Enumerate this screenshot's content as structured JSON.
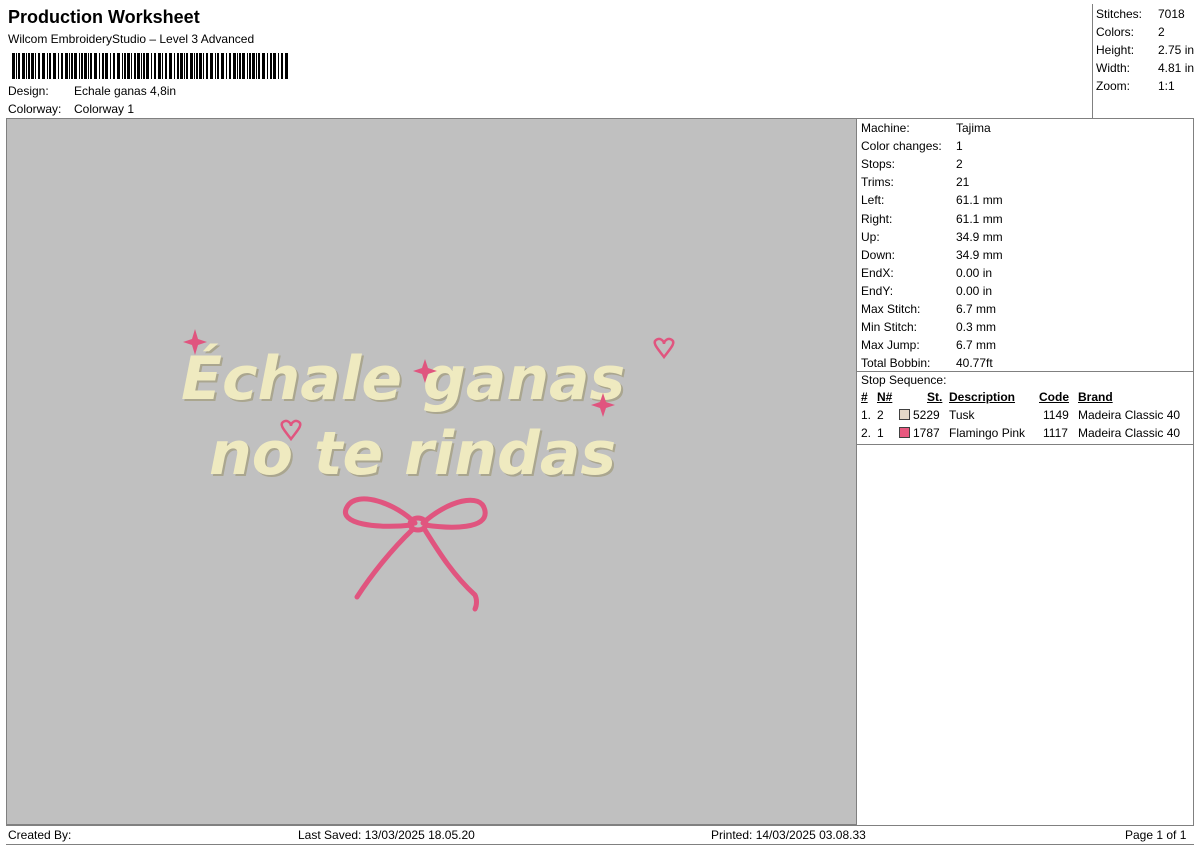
{
  "header": {
    "title": "Production Worksheet",
    "subtitle": "Wilcom EmbroideryStudio – Level 3 Advanced",
    "design_label": "Design:",
    "design_value": "Echale ganas 4,8in",
    "colorway_label": "Colorway:",
    "colorway_value": "Colorway 1"
  },
  "stats": [
    {
      "label": "Stitches:",
      "value": "7018"
    },
    {
      "label": "Colors:",
      "value": "2"
    },
    {
      "label": "Height:",
      "value": "2.75 in"
    },
    {
      "label": "Width:",
      "value": "4.81 in"
    },
    {
      "label": "Zoom:",
      "value": "1:1"
    }
  ],
  "machine_info": [
    {
      "label": "Machine:",
      "value": "Tajima"
    },
    {
      "label": "Color changes:",
      "value": "1"
    },
    {
      "label": "Stops:",
      "value": "2"
    },
    {
      "label": "Trims:",
      "value": "21"
    },
    {
      "label": "Left:",
      "value": "61.1 mm"
    },
    {
      "label": "Right:",
      "value": "61.1 mm"
    },
    {
      "label": "Up:",
      "value": "34.9 mm"
    },
    {
      "label": "Down:",
      "value": "34.9 mm"
    },
    {
      "label": "EndX:",
      "value": "0.00 in"
    },
    {
      "label": "EndY:",
      "value": "0.00 in"
    },
    {
      "label": "Max Stitch:",
      "value": "6.7 mm"
    },
    {
      "label": "Min Stitch:",
      "value": "0.3 mm"
    },
    {
      "label": "Max Jump:",
      "value": "6.7 mm"
    },
    {
      "label": "Total Bobbin:",
      "value": "40.77ft"
    }
  ],
  "stop_sequence": {
    "title": "Stop Sequence:",
    "headers": {
      "idx": "#",
      "n": "N#",
      "st": "St.",
      "desc": "Description",
      "code": "Code",
      "brand": "Brand"
    },
    "rows": [
      {
        "idx": "1.",
        "n": "2",
        "color": "#e5d8c8",
        "st": "5229",
        "desc": "Tusk",
        "code": "1149",
        "brand": "Madeira Classic 40"
      },
      {
        "idx": "2.",
        "n": "1",
        "color": "#e8587f",
        "st": "1787",
        "desc": "Flamingo Pink",
        "code": "1117",
        "brand": "Madeira Classic 40"
      }
    ]
  },
  "design_preview": {
    "line1": "Échale ganas",
    "line2": "no te rindas",
    "text_color": "#efeac0",
    "accent_color": "#e0557f"
  },
  "footer": {
    "created_by": "Created By:",
    "last_saved": "Last Saved: 13/03/2025 18.05.20",
    "printed": "Printed: 14/03/2025 03.08.33",
    "page": "Page 1 of 1"
  }
}
